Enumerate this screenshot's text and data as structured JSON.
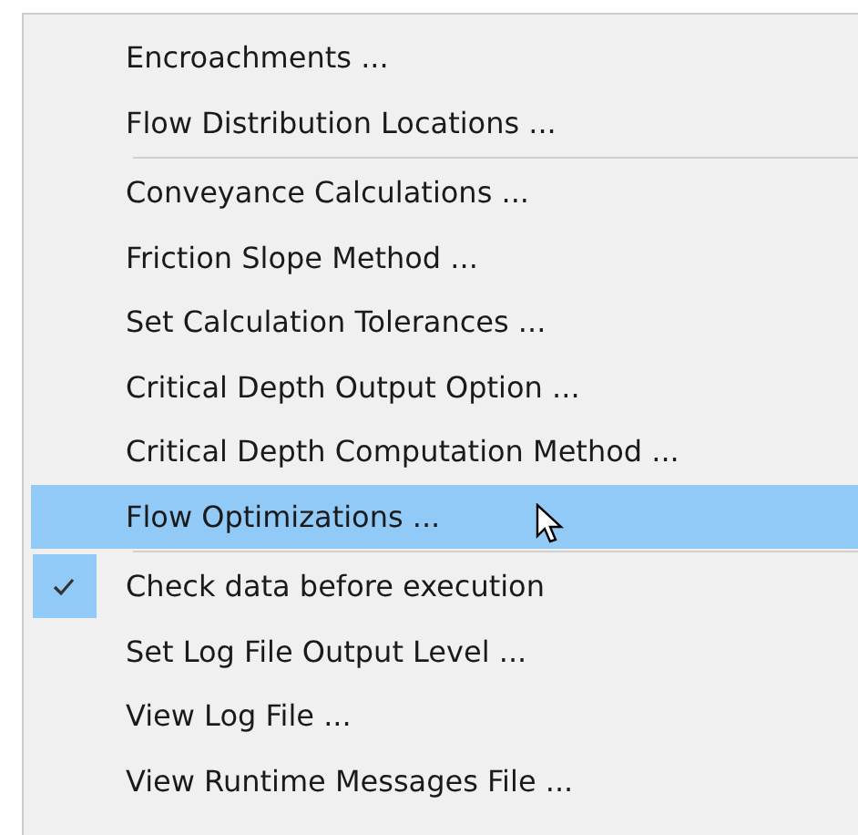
{
  "menu": {
    "sections": [
      {
        "items": [
          {
            "label": "Encroachments ...",
            "selected": false,
            "checked": false
          },
          {
            "label": "Flow Distribution Locations ...",
            "selected": false,
            "checked": false
          }
        ]
      },
      {
        "items": [
          {
            "label": "Conveyance Calculations ...",
            "selected": false,
            "checked": false
          },
          {
            "label": "Friction Slope Method ...",
            "selected": false,
            "checked": false
          },
          {
            "label": "Set Calculation Tolerances ...",
            "selected": false,
            "checked": false
          },
          {
            "label": "Critical Depth Output Option ...",
            "selected": false,
            "checked": false
          },
          {
            "label": "Critical Depth Computation Method ...",
            "selected": false,
            "checked": false
          },
          {
            "label": "Flow Optimizations ...",
            "selected": true,
            "checked": false
          }
        ]
      },
      {
        "items": [
          {
            "label": "Check data before execution",
            "selected": false,
            "checked": true
          },
          {
            "label": "Set Log File Output Level ...",
            "selected": false,
            "checked": false
          },
          {
            "label": "View Log File ...",
            "selected": false,
            "checked": false
          },
          {
            "label": "View Runtime Messages File ...",
            "selected": false,
            "checked": false
          }
        ]
      }
    ]
  }
}
